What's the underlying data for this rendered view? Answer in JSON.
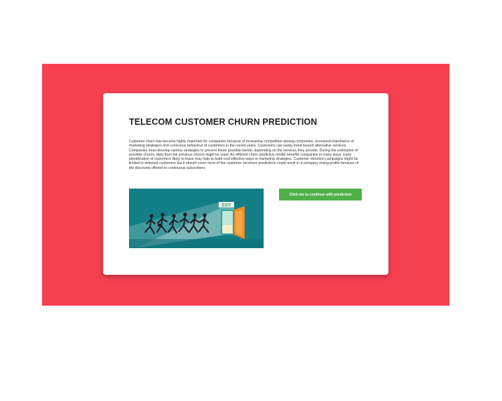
{
  "page": {
    "title": "TELECOM CUSTOMER CHURN PREDICTION",
    "description": "Customer churn has become highly important for companies because of increasing competition among companies, increased importance of marketing strategies and conscious behaviour of customers in the recent years. Customers can easily trend toward alternative services. Companies must develop various strategies to prevent these possible trends, depending on the services they provide. During the estimation of possible churns, data from the previous churns might be used. An efficient churn predictive model benefits companies in many ways. Early identification of customers likely to leave may help to build cost effective ways in marketing strategies. Customer retention campaigns might be limited to selected customers but it should cover most of the customer. Incorrect predictions could result in a company losing profits because of the discounts offered to continuous subscribers.",
    "cta_label": "Click me to continue with prediction"
  },
  "illustration": {
    "icon": "people-running-to-exit-icon",
    "sign_text": "EXIT"
  },
  "colors": {
    "hero_background": "#f64052",
    "card_background": "#ffffff",
    "illustration_background": "#127f87",
    "cta_background": "#4fb048",
    "door": "#f08a24"
  }
}
